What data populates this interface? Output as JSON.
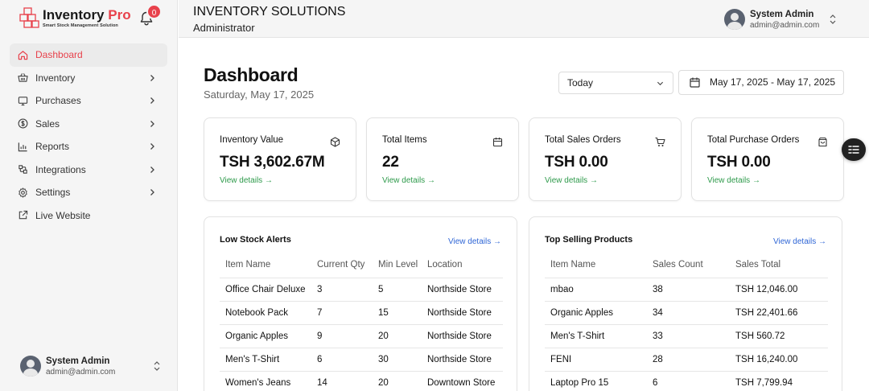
{
  "brand": {
    "name_main": "Inventory",
    "name_accent": " Pro",
    "tagline": "Smart Stock Management Solution",
    "accent_color": "#e8414b"
  },
  "notifications": {
    "count": "0",
    "icon": "bell-icon"
  },
  "sidebar": {
    "items": [
      {
        "label": "Dashboard",
        "icon": "home-icon",
        "active": true,
        "has_children": false
      },
      {
        "label": "Inventory",
        "icon": "basket-icon",
        "has_children": true
      },
      {
        "label": "Purchases",
        "icon": "monitor-icon",
        "has_children": true
      },
      {
        "label": "Sales",
        "icon": "dollar-circle-icon",
        "has_children": true
      },
      {
        "label": "Reports",
        "icon": "bar-chart-icon",
        "has_children": true
      },
      {
        "label": "Integrations",
        "icon": "plug-icon",
        "has_children": true
      },
      {
        "label": "Settings",
        "icon": "gear-icon",
        "has_children": true
      },
      {
        "label": "Live Website",
        "icon": "external-link-icon",
        "has_children": false
      }
    ],
    "user": {
      "name": "System Admin",
      "email": "admin@admin.com"
    }
  },
  "header": {
    "org_name": "INVENTORY SOLUTIONS",
    "role": "Administrator",
    "user": {
      "name": "System Admin",
      "email": "admin@admin.com"
    }
  },
  "main": {
    "title": "Dashboard",
    "date": "Saturday, May 17, 2025",
    "range_select": {
      "value": "Today"
    },
    "date_range": "May 17, 2025 - May 17, 2025",
    "stats": [
      {
        "label": "Inventory Value",
        "value": "TSH 3,602.67M",
        "link": "View details →",
        "icon": "cube-icon"
      },
      {
        "label": "Total Items",
        "value": "22",
        "link": "View details →",
        "icon": "calendar-box-icon"
      },
      {
        "label": "Total Sales Orders",
        "value": "TSH 0.00",
        "link": "View details →",
        "icon": "cart-icon"
      },
      {
        "label": "Total Purchase Orders",
        "value": "TSH 0.00",
        "link": "View details →",
        "icon": "bag-icon"
      }
    ],
    "low_stock": {
      "title": "Low Stock Alerts",
      "link": "View details →",
      "columns": [
        "Item Name",
        "Current Qty",
        "Min Level",
        "Location"
      ],
      "rows": [
        [
          "Office Chair Deluxe",
          "3",
          "5",
          "Northside Store"
        ],
        [
          "Notebook Pack",
          "7",
          "15",
          "Northside Store"
        ],
        [
          "Organic Apples",
          "9",
          "20",
          "Northside Store"
        ],
        [
          "Men's T-Shirt",
          "6",
          "30",
          "Northside Store"
        ],
        [
          "Women's Jeans",
          "14",
          "20",
          "Downtown Store"
        ]
      ]
    },
    "top_selling": {
      "title": "Top Selling Products",
      "link": "View details →",
      "columns": [
        "Item Name",
        "Sales Count",
        "Sales Total"
      ],
      "rows": [
        [
          "mbao",
          "38",
          "TSH 12,046.00"
        ],
        [
          "Organic Apples",
          "34",
          "TSH 22,401.66"
        ],
        [
          "Men's T-Shirt",
          "33",
          "TSH 560.72"
        ],
        [
          "FENI",
          "28",
          "TSH 16,240.00"
        ],
        [
          "Laptop Pro 15",
          "6",
          "TSH 7,799.94"
        ]
      ]
    }
  },
  "floating_button": {
    "icon": "filter-list-icon"
  }
}
